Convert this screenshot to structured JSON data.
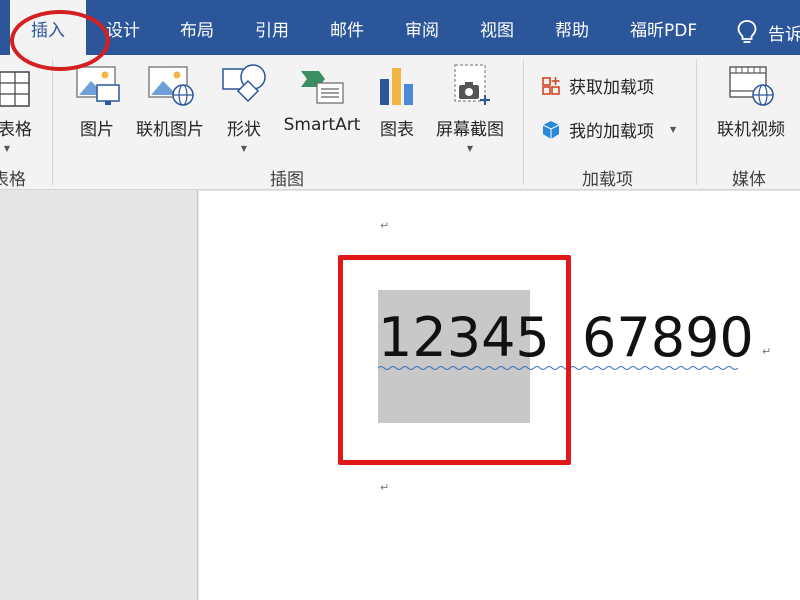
{
  "tabs": {
    "insert": "插入",
    "design": "设计",
    "layout": "布局",
    "references": "引用",
    "mailings": "邮件",
    "review": "审阅",
    "view": "视图",
    "help": "帮助",
    "foxit_pdf": "福昕PDF",
    "tell_me": "告诉"
  },
  "ribbon": {
    "table_label": "表格",
    "table_group_label": "表格",
    "pictures_label": "图片",
    "online_pictures_label": "联机图片",
    "shapes_label": "形状",
    "smartart_label": "SmartArt",
    "chart_label": "图表",
    "screenshot_label": "屏幕截图",
    "illustrations_group_label": "插图",
    "get_addins_label": "获取加载项",
    "my_addins_label": "我的加载项",
    "addins_group_label": "加载项",
    "online_video_label": "联机视频",
    "media_group_label": "媒体"
  },
  "document": {
    "selected_text": "12345",
    "other_text": "67890",
    "paragraph_mark": "↵"
  },
  "colors": {
    "ribbon_blue": "#2b579a",
    "annotation_red": "#e01818",
    "selection_gray": "#c8c8c8"
  }
}
